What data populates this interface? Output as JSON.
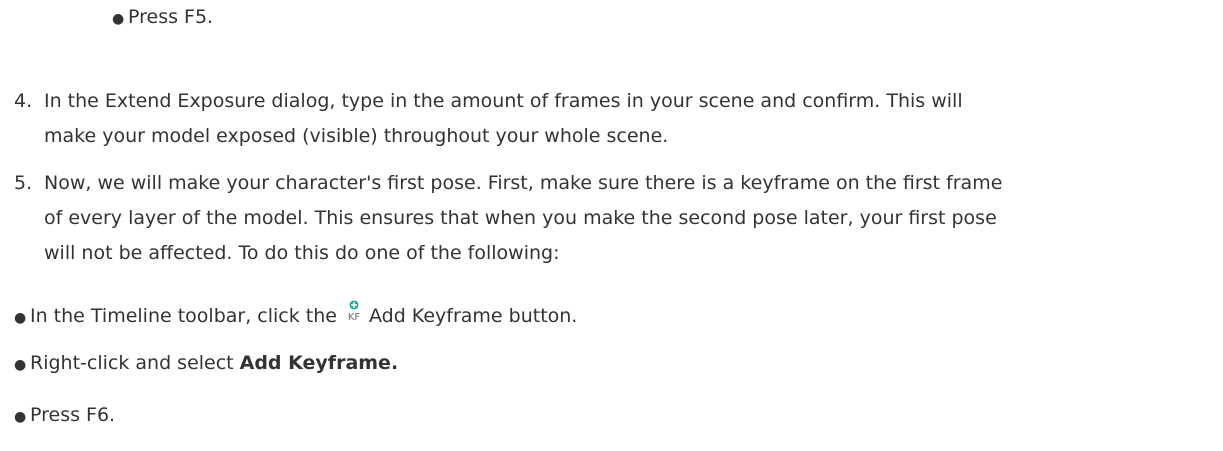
{
  "bullet_press_f5": "Press F5.",
  "step4": {
    "number": "4.",
    "line1": "In the Extend Exposure dialog, type in the amount of frames in your scene and confirm. This will",
    "line2": "make your model exposed (visible) throughout your whole scene."
  },
  "step5": {
    "number": "5.",
    "line1": "Now, we will make your character's first pose. First, make sure there is a keyframe on the first frame",
    "line2": "of every layer of the model. This ensures that when you make the second pose later, your first pose",
    "line3": "will not be affected. To do this do one of the following:"
  },
  "options": {
    "timeline_prefix": "In the Timeline toolbar, click the",
    "timeline_suffix": "Add Keyframe button.",
    "rightclick_prefix": "Right-click and select",
    "rightclick_bold": "Add Keyframe.",
    "press_f6": "Press F6."
  },
  "icons": {
    "add_keyframe": "add-keyframe-icon"
  },
  "colors": {
    "text": "#333333",
    "icon_teal": "#1aa89a",
    "icon_gray": "#6b6b6b"
  }
}
